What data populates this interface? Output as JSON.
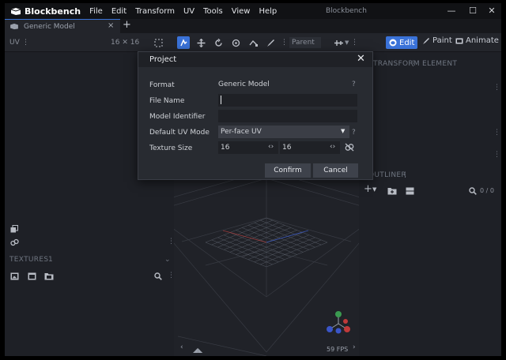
{
  "titlebar": {
    "app_logo_text": "Blockbench",
    "menus": [
      "File",
      "Edit",
      "Transform",
      "UV",
      "Tools",
      "View",
      "Help"
    ],
    "window_title": "Blockbench",
    "minimize": "—",
    "maximize": "☐",
    "close": "✕"
  },
  "tabs": {
    "active_tab": "Generic Model",
    "close": "×",
    "add": "+"
  },
  "toolbar": {
    "uv_label": "UV",
    "uv_dots": "⋮",
    "uv_size": "16 ✕ 16",
    "parent_label": "Parent",
    "modes": {
      "edit": "Edit",
      "paint": "Paint",
      "animate": "Animate"
    }
  },
  "left_panel": {
    "textures_header": "TEXTURES",
    "textures_count": "1"
  },
  "right_panel": {
    "transform_header": "TRANSFORM",
    "element_header": "ELEMENT",
    "outliner_header": "OUTLINER",
    "outliner_count": "0 / 0"
  },
  "viewport": {
    "fps": "59 FPS"
  },
  "dialog": {
    "title": "Project",
    "close": "✕",
    "rows": {
      "format": {
        "label": "Format",
        "value": "Generic Model"
      },
      "file_name": {
        "label": "File Name",
        "value": ""
      },
      "model_identifier": {
        "label": "Model Identifier",
        "value": ""
      },
      "uv_mode": {
        "label": "Default UV Mode",
        "value": "Per-face UV"
      },
      "texture_size": {
        "label": "Texture Size",
        "width": "16",
        "height": "16"
      }
    },
    "help_mark": "?",
    "confirm": "Confirm",
    "cancel": "Cancel"
  },
  "colors": {
    "accent": "#3a72d8",
    "background": "#1b1d22",
    "dialog": "#282b31"
  }
}
